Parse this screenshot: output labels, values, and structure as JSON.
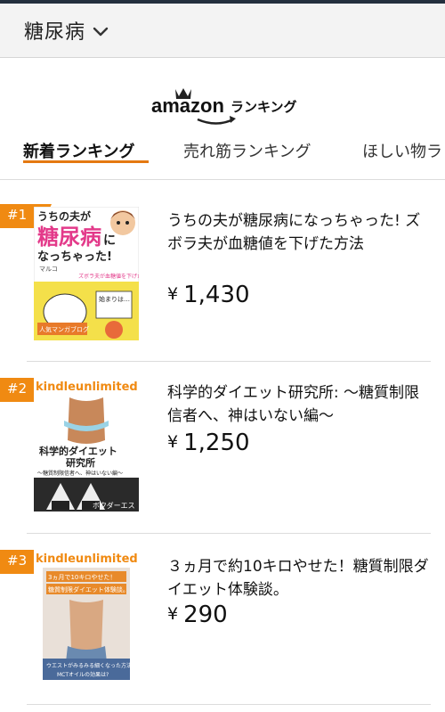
{
  "header": {
    "category": "糖尿病"
  },
  "logo": {
    "brand": "amazon",
    "suffix": "ランキング"
  },
  "tabs": [
    {
      "label": "新着ランキング"
    },
    {
      "label": "売れ筋ランキング"
    },
    {
      "label": "ほしい物ラ"
    }
  ],
  "colors": {
    "accent": "#e47911",
    "badge": "#f08a12",
    "topbar": "#232f3e"
  },
  "items": [
    {
      "rank": "#1",
      "title": "うちの夫が糖尿病になっちゃった! ズボラ夫が血糖値を下げた方法",
      "price": "1,430",
      "currency": "¥",
      "cover": {
        "l1": "うちの夫が",
        "l2": "糖尿病",
        "l3": "に",
        "l4": "なっちゃった!",
        "author": "マルコ",
        "sub": "ズボラ夫が血糖値を下げた方法",
        "bubble": "始まりは…",
        "badge": "人気マンガブログ"
      }
    },
    {
      "rank": "#2",
      "title": "科学的ダイエット研究所: 〜糖質制限信者へ、神はいない編〜",
      "price": "1,250",
      "currency": "¥",
      "cover": {
        "banner": "kindleunlimited",
        "t1": "科学的ダイエット",
        "t2": "研究所",
        "t3": "〜糖質制限信者へ、神はいない編〜",
        "foot": "ボクダーエス"
      }
    },
    {
      "rank": "#3",
      "title": "３ヵ月で約10キロやせた！糖質制限ダイエット体験談。",
      "price": "290",
      "currency": "¥",
      "cover": {
        "banner": "kindleunlimited",
        "t1": "3ヵ月で10キロやせた！",
        "t2": "糖質制限ダイエット体験談。",
        "foot": "ウエストがみるみる細くなった方法",
        "foot2": "MCTオイルの効果は?"
      }
    }
  ]
}
